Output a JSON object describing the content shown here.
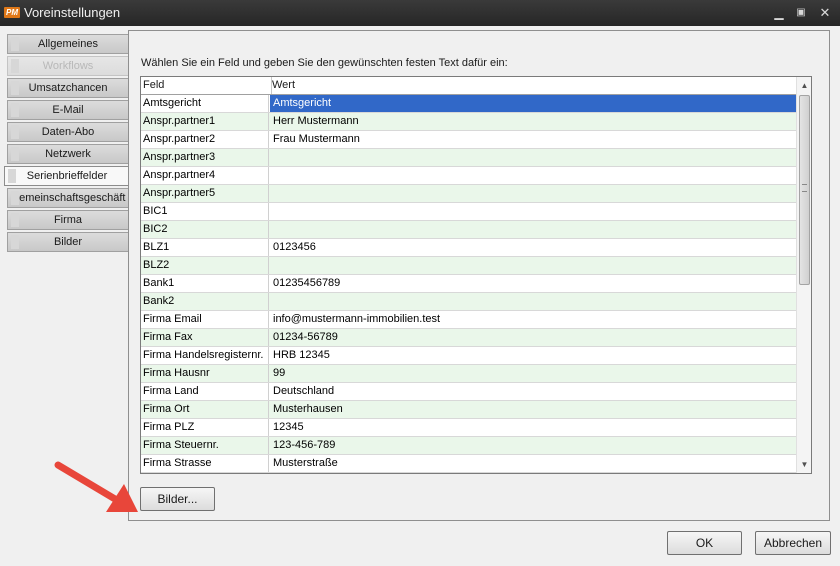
{
  "window": {
    "title": "Voreinstellungen",
    "app_icon_text": "PM"
  },
  "nav": {
    "items": [
      {
        "label": "Allgemeines",
        "state": "normal"
      },
      {
        "label": "Workflows",
        "state": "disabled"
      },
      {
        "label": "Umsatzchancen",
        "state": "normal"
      },
      {
        "label": "E-Mail",
        "state": "normal"
      },
      {
        "label": "Daten-Abo",
        "state": "normal"
      },
      {
        "label": "Netzwerk",
        "state": "normal"
      },
      {
        "label": "Serienbrieffelder",
        "state": "active"
      },
      {
        "label": "Gemeinschaftsgeschäft",
        "state": "normal"
      },
      {
        "label": "Firma",
        "state": "normal"
      },
      {
        "label": "Bilder",
        "state": "normal"
      }
    ]
  },
  "panel": {
    "instruction": "Wählen Sie ein Feld und geben Sie den gewünschten festen Text dafür ein:",
    "columns": {
      "field": "Feld",
      "value": "Wert"
    },
    "rows": [
      {
        "field": "Amtsgericht",
        "value": "Amtsgericht"
      },
      {
        "field": "Anspr.partner1",
        "value": "Herr Mustermann"
      },
      {
        "field": "Anspr.partner2",
        "value": "Frau Mustermann"
      },
      {
        "field": "Anspr.partner3",
        "value": ""
      },
      {
        "field": "Anspr.partner4",
        "value": ""
      },
      {
        "field": "Anspr.partner5",
        "value": ""
      },
      {
        "field": "BIC1",
        "value": ""
      },
      {
        "field": "BIC2",
        "value": ""
      },
      {
        "field": "BLZ1",
        "value": "0123456"
      },
      {
        "field": "BLZ2",
        "value": ""
      },
      {
        "field": "Bank1",
        "value": "01235456789"
      },
      {
        "field": "Bank2",
        "value": ""
      },
      {
        "field": "Firma Email",
        "value": "info@mustermann-immobilien.test"
      },
      {
        "field": "Firma Fax",
        "value": "01234-56789"
      },
      {
        "field": "Firma Handelsregisternr.",
        "value": "HRB 12345"
      },
      {
        "field": "Firma Hausnr",
        "value": "99"
      },
      {
        "field": "Firma Land",
        "value": "Deutschland"
      },
      {
        "field": "Firma Ort",
        "value": "Musterhausen"
      },
      {
        "field": "Firma PLZ",
        "value": "12345"
      },
      {
        "field": "Firma Steuernr.",
        "value": "123-456-789"
      },
      {
        "field": "Firma Strasse",
        "value": "Musterstraße"
      }
    ],
    "selected_index": 0,
    "bilder_button": "Bilder..."
  },
  "footer": {
    "ok_label": "OK",
    "cancel_label": "Abbrechen"
  },
  "colors": {
    "selection": "#3168c8",
    "alt_row": "#eaf7ea",
    "arrow": "#e8463a",
    "app_icon": "#e07818"
  }
}
